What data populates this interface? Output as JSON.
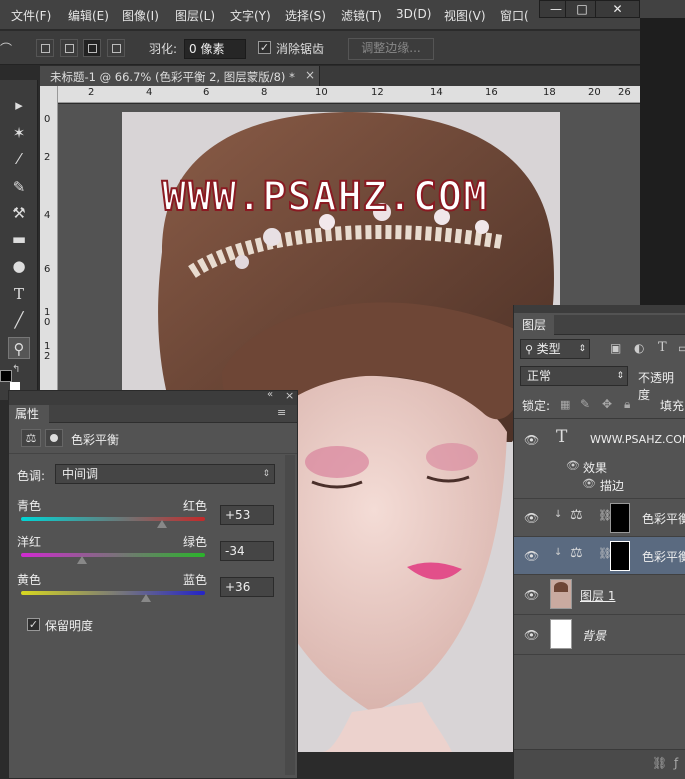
{
  "menu": [
    "文件(F)",
    "编辑(E)",
    "图像(I)",
    "图层(L)",
    "文字(Y)",
    "选择(S)",
    "滤镜(T)",
    "3D(D)",
    "视图(V)",
    "窗口("
  ],
  "window_buttons": [
    "—",
    "□",
    "✕"
  ],
  "options": {
    "feather_label": "羽化:",
    "feather_value": "0 像素",
    "antialias_label": "消除锯齿",
    "refine_edge_label": "调整边缘..."
  },
  "document": {
    "tab_title": "未标题-1 @ 66.7% (色彩平衡 2, 图层蒙版/8) *",
    "close": "×",
    "ruler_h": [
      "2",
      "4",
      "6",
      "8",
      "10",
      "12",
      "14",
      "16",
      "18",
      "20",
      "22",
      "24",
      "26"
    ],
    "ruler_v": [
      "0",
      "2",
      "4",
      "6",
      "8",
      "1 0",
      "1 2",
      "1 4"
    ]
  },
  "watermark": "WWW.PSAHZ.COM",
  "properties": {
    "tab_label": "属性",
    "title": "色彩平衡",
    "tone_label": "色调:",
    "tone_value": "中间调",
    "sliders": [
      {
        "left": "青色",
        "right": "红色",
        "value": "+53",
        "position": 0.765,
        "colors": [
          "#00d6d6",
          "#c42a2a"
        ]
      },
      {
        "left": "洋红",
        "right": "绿色",
        "value": "-34",
        "position": 0.33,
        "colors": [
          "#d02ad0",
          "#2ab42a"
        ]
      },
      {
        "left": "黄色",
        "right": "蓝色",
        "value": "+36",
        "position": 0.68,
        "colors": [
          "#d8d820",
          "#2424c8"
        ]
      }
    ],
    "preserve_luminosity": "保留明度"
  },
  "layers": {
    "tab_label": "图层",
    "filter_label": "类型",
    "blend_mode": "正常",
    "opacity_label": "不透明度",
    "lock_label": "锁定:",
    "fill_label": "填充",
    "items": [
      {
        "name": "WWW.PSAHZ.COM",
        "kind": "text"
      },
      {
        "name": "效果",
        "kind": "effect"
      },
      {
        "name": "描边",
        "kind": "effect-item"
      },
      {
        "name": "色彩平衡",
        "kind": "adjustment"
      },
      {
        "name": "色彩平衡",
        "kind": "adjustment-selected"
      },
      {
        "name": "图层 1",
        "kind": "image"
      },
      {
        "name": "背景",
        "kind": "background"
      }
    ]
  },
  "colors": {
    "accent_selected": "#5a6a80",
    "panel": "#535353"
  }
}
